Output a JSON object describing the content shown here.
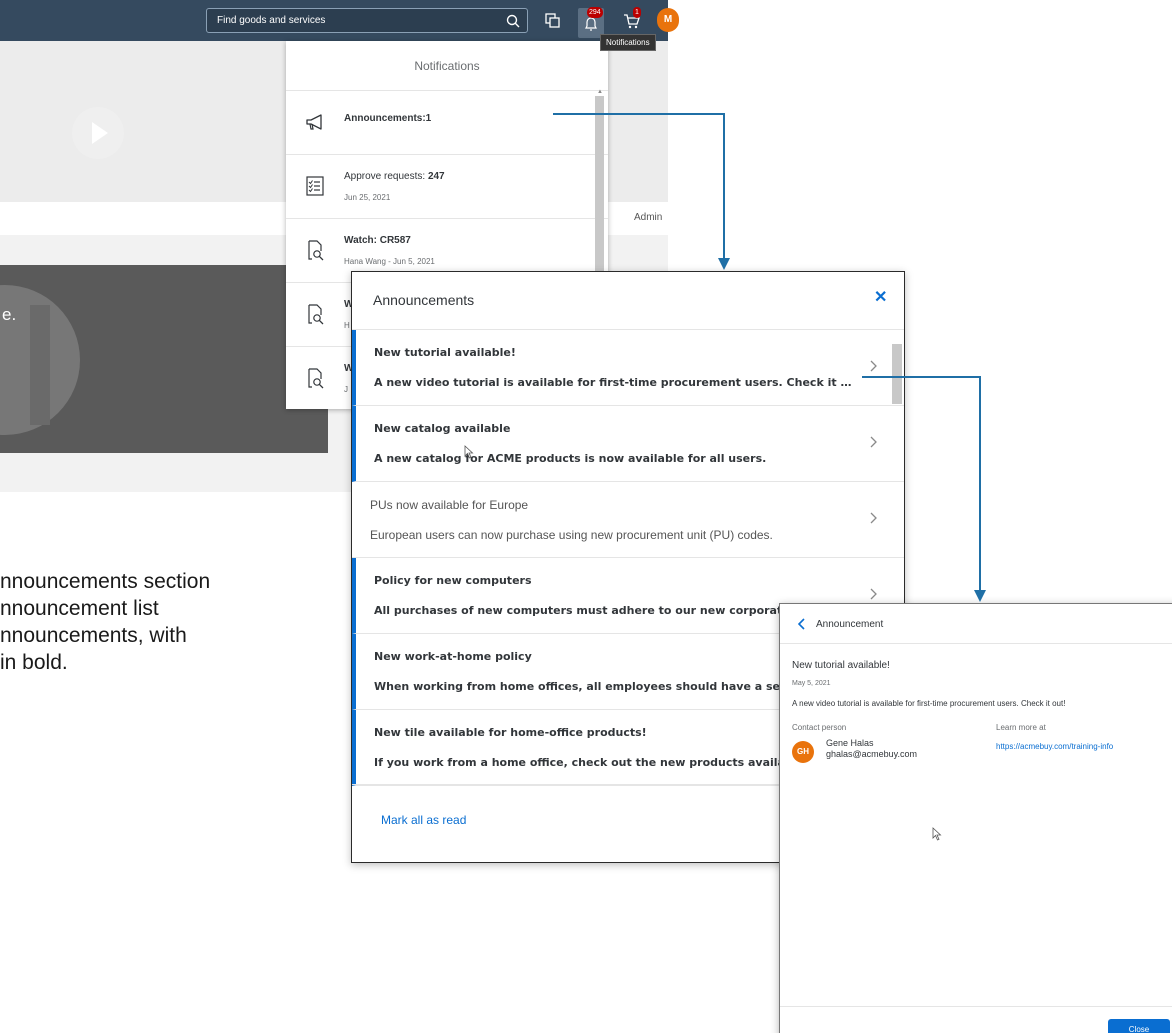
{
  "shell": {
    "search_placeholder": "Find goods and services",
    "notification_count": "294",
    "cart_count": "1",
    "avatar_initial": "M",
    "tooltip": "Notifications"
  },
  "background": {
    "admin_label": "Admin",
    "video_caption": "e."
  },
  "side_note": {
    "line1": "nnouncements section",
    "line2": "nnouncement list",
    "line3": "nnouncements, with",
    "line4": "in bold."
  },
  "notifications": {
    "title": "Notifications",
    "items": [
      {
        "icon": "megaphone-icon",
        "title": "Announcements:1",
        "sub": ""
      },
      {
        "icon": "checklist-icon",
        "title_prefix": "Approve requests: ",
        "title_bold": "247",
        "sub": "Jun 25, 2021"
      },
      {
        "icon": "document-search-icon",
        "title": "Watch: CR587",
        "sub": "Hana Wang - Jun 5, 2021"
      },
      {
        "icon": "document-search-icon",
        "title": "W",
        "sub": "H"
      },
      {
        "icon": "document-search-icon",
        "title": "W",
        "sub": "J"
      }
    ]
  },
  "announcements": {
    "title": "Announcements",
    "items": [
      {
        "title": "New tutorial available!",
        "desc": "A new video tutorial is available for first-time procurement users. Check it out!",
        "unread": true
      },
      {
        "title": "New catalog available",
        "desc": "A new catalog for ACME products is now available for all users.",
        "unread": true
      },
      {
        "title": "PUs now available for Europe",
        "desc": "European users can now purchase using new procurement unit (PU) codes.",
        "unread": false
      },
      {
        "title": "Policy for new computers",
        "desc": "All purchases of new computers must adhere to our new corporate policy.",
        "unread": true
      },
      {
        "title": "New work-at-home policy",
        "desc": "When working from home offices, all employees should have a secure connection.",
        "unread": true
      },
      {
        "title": "New tile available for home-office products!",
        "desc": "If you work from a home office, check out the new products available.",
        "unread": true
      }
    ],
    "mark_all_read": "Mark all as read"
  },
  "detail": {
    "title": "Announcement",
    "subject": "New tutorial available!",
    "date": "May 5, 2021",
    "body": "A new video tutorial is available for first-time procurement users. Check it out!",
    "contact_label": "Contact person",
    "contact_initials": "GH",
    "contact_name": "Gene Halas",
    "contact_email": "ghalas@acmebuy.com",
    "learn_label": "Learn more at",
    "learn_link": "https://acmebuy.com/training-info",
    "close_label": "Close"
  },
  "colors": {
    "shell": "#354a5f",
    "accent": "#0a6ed1",
    "badge": "#bb0000",
    "avatar": "#e9730c"
  }
}
